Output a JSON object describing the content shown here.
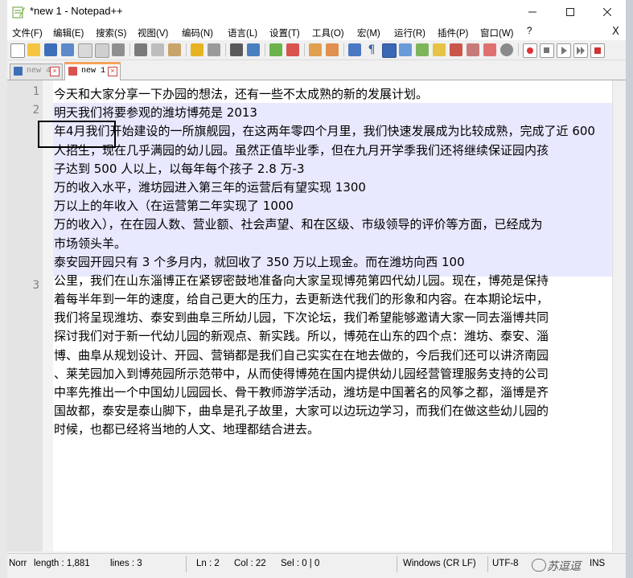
{
  "window": {
    "title": "*new 1 - Notepad++"
  },
  "menu": [
    "文件(F)",
    "编辑(E)",
    "搜索(S)",
    "视图(V)",
    "编码(N)",
    "语言(L)",
    "设置(T)",
    "工具(O)",
    "宏(M)",
    "运行(R)",
    "插件(P)",
    "窗口(W)",
    "?"
  ],
  "menu_close": "X",
  "tabs": [
    {
      "label": "new 4",
      "active": false
    },
    {
      "label": "new 1",
      "active": true
    }
  ],
  "editor": {
    "line_numbers": [
      "1",
      "2",
      "3"
    ],
    "lines": [
      "今天和大家分享一下办园的想法，还有一些不太成熟的新的发展计划。",
      "明天我们将要参观的潍坊博苑是 2013",
      "年4月我们开始建设的一所旗舰园，在这两年零四个月里，我们快速发展成为比较成熟，完成了近 600",
      "人招生，现在几乎满园的幼儿园。虽然正值毕业季，但在九月开学季我们还将继续保证园内孩",
      "子达到 500 人以上，以每年每个孩子 2.8 万-3",
      "万的收入水平，潍坊园进入第三年的运营后有望实现 1300",
      "万以上的年收入（在运营第二年实现了 1000",
      "万的收入），在在园人数、营业额、社会声望、和在区级、市级领导的评价等方面，已经成为",
      "市场领头羊。",
      "泰安园开园只有 3 个多月内，就回收了 350 万以上现金。而在潍坊向西 100",
      "公里，我们在山东淄博正在紧锣密鼓地准备向大家呈现博苑第四代幼儿园。现在，博苑是保持",
      "着每半年到一年的速度，给自己更大的压力，去更新迭代我们的形象和内容。在本期论坛中，",
      "我们将呈现潍坊、泰安到曲阜三所幼儿园，下次论坛，我们希望能够邀请大家一同去淄博共同",
      "探讨我们对于新一代幼儿园的新观点、新实践。所以，博苑在山东的四个点：潍坊、泰安、淄",
      "博、曲阜从规划设计、开园、营销都是我们自己实实在在地去做的，今后我们还可以讲济南园",
      "、莱芜园加入到博苑园所示范带中，从而使得博苑在国内提供幼儿园经营管理服务支持的公司",
      "中率先推出一个中国幼儿园园长、骨干教师游学活动，潍坊是中国著名的风筝之都，淄博是齐",
      "国故都，泰安是泰山脚下，曲阜是孔子故里，大家可以边玩边学习，而我们在做这些幼儿园的",
      "时候，也都已经将当地的人文、地理都结合进去。"
    ]
  },
  "status": {
    "doc_type": "Norr",
    "length": "length : 1,881",
    "lines": "lines : 3",
    "ln": "Ln : 2",
    "col": "Col : 22",
    "sel": "Sel : 0 | 0",
    "eol": "Windows (CR LF)",
    "encoding": "UTF-8",
    "mode": "INS"
  },
  "watermark": "苏逗逗"
}
